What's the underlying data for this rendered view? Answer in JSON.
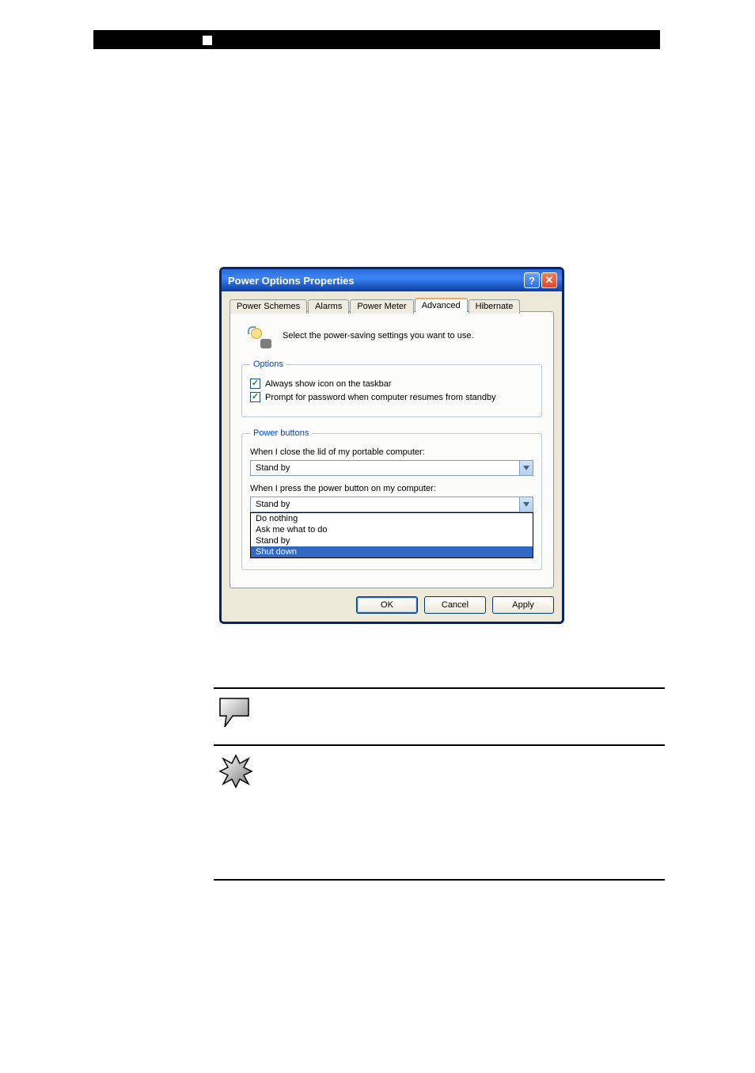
{
  "dialog": {
    "title": "Power Options Properties",
    "tabs": [
      "Power Schemes",
      "Alarms",
      "Power Meter",
      "Advanced",
      "Hibernate"
    ],
    "active_tab_index": 3,
    "intro": "Select the power-saving settings you want to use.",
    "options_group": {
      "legend": "Options",
      "items": [
        {
          "label": "Always show icon on the taskbar",
          "checked": true
        },
        {
          "label": "Prompt for password when computer resumes from standby",
          "checked": true
        }
      ]
    },
    "power_buttons_group": {
      "legend": "Power buttons",
      "close_lid_label": "When I close the lid of my portable computer:",
      "close_lid_value": "Stand by",
      "power_button_label": "When I press the power button on my computer:",
      "power_button_value": "Stand by",
      "power_button_options": [
        "Do nothing",
        "Ask me what to do",
        "Stand by",
        "Shut down"
      ],
      "power_button_highlighted_index": 3
    },
    "buttons": {
      "ok": "OK",
      "cancel": "Cancel",
      "apply": "Apply"
    }
  }
}
